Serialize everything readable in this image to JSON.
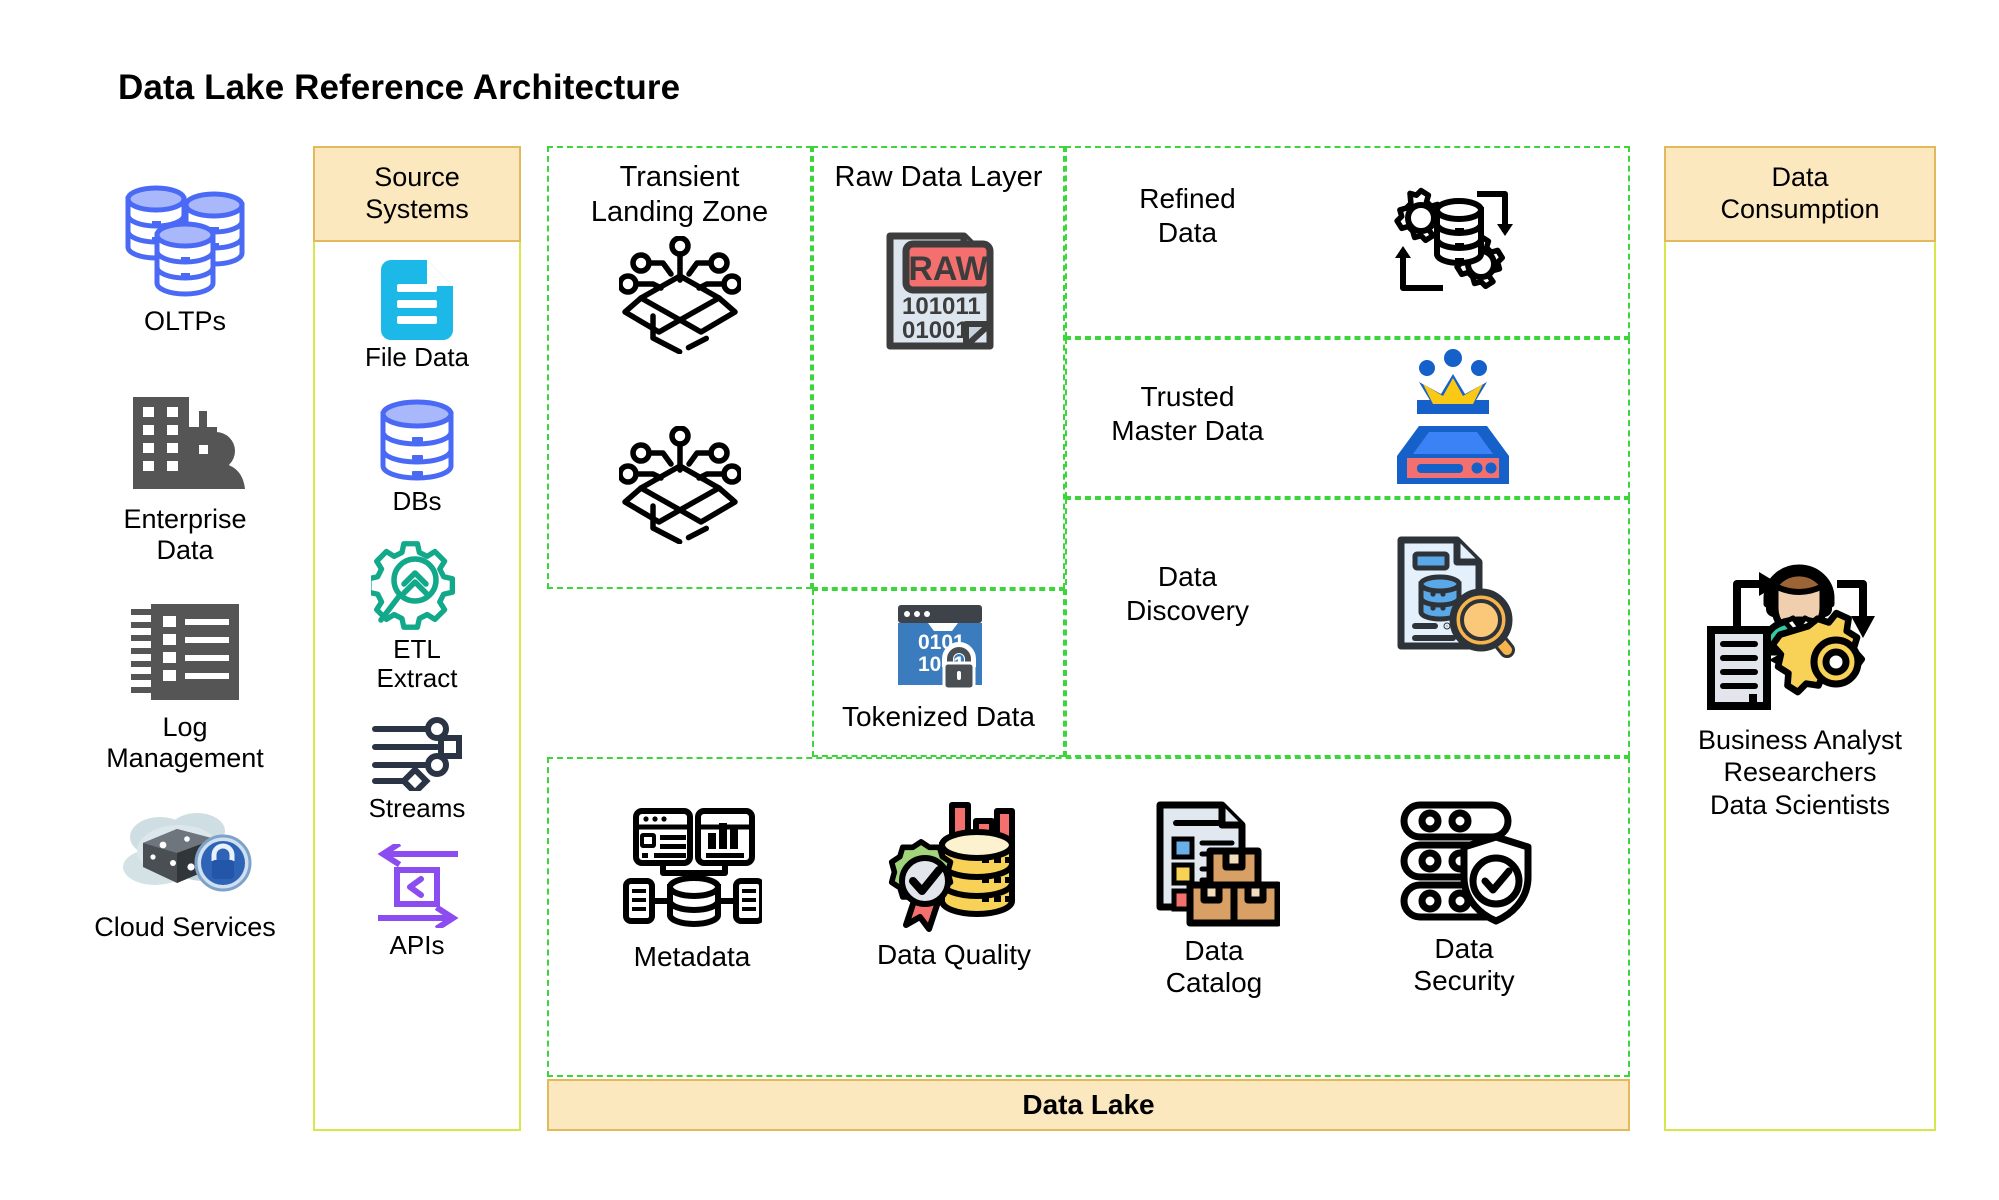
{
  "title": "Data Lake Reference Architecture",
  "sources": {
    "items": [
      {
        "label": "OLTPs",
        "icon": "database-cluster-icon"
      },
      {
        "label": "Enterprise\nData",
        "icon": "enterprise-building-person-icon"
      },
      {
        "label": "Log\nManagement",
        "icon": "log-list-icon"
      },
      {
        "label": "Cloud Services",
        "icon": "cloud-lock-icon"
      }
    ]
  },
  "source_systems": {
    "header": "Source\nSystems",
    "items": [
      {
        "label": "File Data",
        "icon": "file-data-icon"
      },
      {
        "label": "DBs",
        "icon": "database-icon"
      },
      {
        "label": "ETL\nExtract",
        "icon": "etl-extract-gear-magnifier-icon"
      },
      {
        "label": "Streams",
        "icon": "streams-icon"
      },
      {
        "label": "APIs",
        "icon": "apis-exchange-icon"
      }
    ]
  },
  "lake": {
    "footer_label": "Data Lake",
    "transient": {
      "title": "Transient\nLanding Zone",
      "icon_top": "open-box-network-icon",
      "icon_bottom": "open-box-network-icon"
    },
    "raw": {
      "title": "Raw Data Layer",
      "icon": "raw-document-icon",
      "raw_badge": "RAW",
      "binary_line1": "101011",
      "binary_line2": "01001"
    },
    "tokenized": {
      "label": "Tokenized Data",
      "icon": "tokenized-lock-window-icon",
      "binary_line1": "0101",
      "binary_line2": "1001"
    },
    "refined": {
      "title": "Refined\nData",
      "icon": "refined-data-gears-icon"
    },
    "trusted": {
      "title": "Trusted\nMaster Data",
      "icon": "crown-server-icon"
    },
    "discovery": {
      "title": "Data\nDiscovery",
      "icon": "data-discovery-magnifier-icon"
    },
    "governance": [
      {
        "label": "Metadata",
        "icon": "metadata-network-icon"
      },
      {
        "label": "Data Quality",
        "icon": "data-quality-badge-icon"
      },
      {
        "label": "Data\nCatalog",
        "icon": "data-catalog-boxes-icon"
      },
      {
        "label": "Data\nSecurity",
        "icon": "data-security-shield-icon"
      }
    ]
  },
  "consumption": {
    "header": "Data\nConsumption",
    "icon": "business-analyst-gear-icon",
    "label": "Business Analyst\nResearchers\nData Scientists"
  },
  "colors": {
    "panel_border": "#d7e64a",
    "header_fill": "#fbe8bf",
    "header_border": "#e2ba5c",
    "dashed_green": "#3cd63c",
    "db_blue": "#4a69f5",
    "file_cyan": "#1cb8e8",
    "etl_teal": "#12a88a",
    "streams_navy": "#2b3445",
    "api_purple": "#8b4cf0",
    "raw_red": "#f4706e",
    "token_blue": "#3a7cbd",
    "crown_yellow": "#fbc913",
    "quality_yellow": "#f7d257",
    "magnifier_orange": "#f7b34c"
  }
}
